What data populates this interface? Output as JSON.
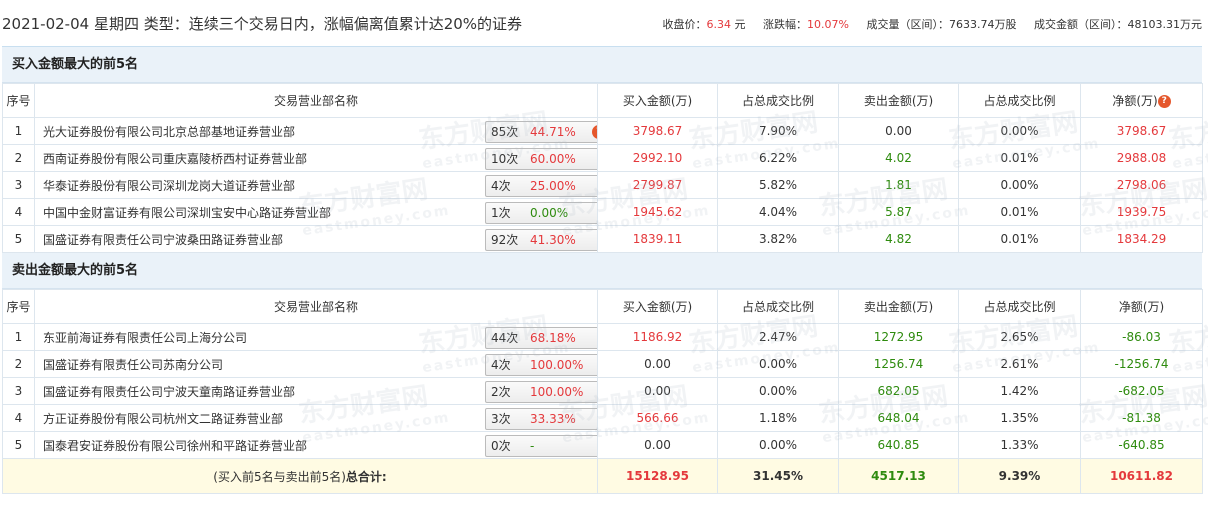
{
  "header": {
    "title": "2021-02-04 星期四  类型：连续三个交易日内，涨幅偏离值累计达20%的证券",
    "close_label": "收盘价：",
    "close_value": "6.34",
    "close_unit": " 元",
    "change_label": "涨跌幅：",
    "change_value": "10.07%",
    "volume": "成交量（区间）：7633.74万股",
    "amount": "成交金额（区间）：48103.31万元"
  },
  "columns": {
    "idx": "序号",
    "name": "交易营业部名称",
    "buy": "买入金额(万)",
    "buy_ratio": "占总成交比例",
    "sell": "卖出金额(万)",
    "sell_ratio": "占总成交比例",
    "net": "净额(万)"
  },
  "buy_section": {
    "title": "买入金额最大的前5名",
    "rows": [
      {
        "idx": "1",
        "name": "光大证券股份有限公司北京总部基地证券营业部",
        "count": "85次",
        "pct": "44.71%",
        "buy": "3798.67",
        "buy_ratio": "7.90%",
        "sell": "0.00",
        "sell_ratio": "0.00%",
        "net": "3798.67",
        "icon": "question-icon"
      },
      {
        "idx": "2",
        "name": "西南证券股份有限公司重庆嘉陵桥西村证券营业部",
        "count": "10次",
        "pct": "60.00%",
        "buy": "2992.10",
        "buy_ratio": "6.22%",
        "sell": "4.02",
        "sell_ratio": "0.01%",
        "net": "2988.08",
        "icon": "arrow-right-icon"
      },
      {
        "idx": "3",
        "name": "华泰证券股份有限公司深圳龙岗大道证券营业部",
        "count": "4次",
        "pct": "25.00%",
        "buy": "2799.87",
        "buy_ratio": "5.82%",
        "sell": "1.81",
        "sell_ratio": "0.00%",
        "net": "2798.06",
        "icon": "arrow-right-icon"
      },
      {
        "idx": "4",
        "name": "中国中金财富证券有限公司深圳宝安中心路证券营业部",
        "count": "1次",
        "pct": "0.00%",
        "buy": "1945.62",
        "buy_ratio": "4.04%",
        "sell": "5.87",
        "sell_ratio": "0.01%",
        "net": "1939.75",
        "icon": "arrow-right-icon"
      },
      {
        "idx": "5",
        "name": "国盛证券有限责任公司宁波桑田路证券营业部",
        "count": "92次",
        "pct": "41.30%",
        "buy": "1839.11",
        "buy_ratio": "3.82%",
        "sell": "4.82",
        "sell_ratio": "0.01%",
        "net": "1834.29",
        "icon": "arrow-right-icon"
      }
    ]
  },
  "sell_section": {
    "title": "卖出金额最大的前5名",
    "rows": [
      {
        "idx": "1",
        "name": "东亚前海证券有限责任公司上海分公司",
        "count": "44次",
        "pct": "68.18%",
        "buy": "1186.92",
        "buy_ratio": "2.47%",
        "sell": "1272.95",
        "sell_ratio": "2.65%",
        "net": "-86.03"
      },
      {
        "idx": "2",
        "name": "国盛证券有限责任公司苏南分公司",
        "count": "4次",
        "pct": "100.00%",
        "buy": "0.00",
        "buy_ratio": "0.00%",
        "sell": "1256.74",
        "sell_ratio": "2.61%",
        "net": "-1256.74"
      },
      {
        "idx": "3",
        "name": "国盛证券有限责任公司宁波天童南路证券营业部",
        "count": "2次",
        "pct": "100.00%",
        "buy": "0.00",
        "buy_ratio": "0.00%",
        "sell": "682.05",
        "sell_ratio": "1.42%",
        "net": "-682.05"
      },
      {
        "idx": "4",
        "name": "方正证券股份有限公司杭州文二路证券营业部",
        "count": "3次",
        "pct": "33.33%",
        "buy": "566.66",
        "buy_ratio": "1.18%",
        "sell": "648.04",
        "sell_ratio": "1.35%",
        "net": "-81.38"
      },
      {
        "idx": "5",
        "name": "国泰君安证券股份有限公司徐州和平路证券营业部",
        "count": "0次",
        "pct": "-",
        "buy": "0.00",
        "buy_ratio": "0.00%",
        "sell": "640.85",
        "sell_ratio": "1.33%",
        "net": "-640.85"
      }
    ]
  },
  "total": {
    "label_prefix": "(买入前5名与卖出前5名)",
    "label_bold": "总合计:",
    "buy": "15128.95",
    "buy_ratio": "31.45%",
    "sell": "4517.13",
    "sell_ratio": "9.39%",
    "net": "10611.82"
  },
  "watermark": {
    "cn": "东方财富网",
    "en": "eastmoney.com"
  },
  "colors": {
    "red": "#e4393c",
    "green": "#2e8b0e",
    "section_bg": "#eaf2f9",
    "total_bg": "#fffbe3"
  }
}
